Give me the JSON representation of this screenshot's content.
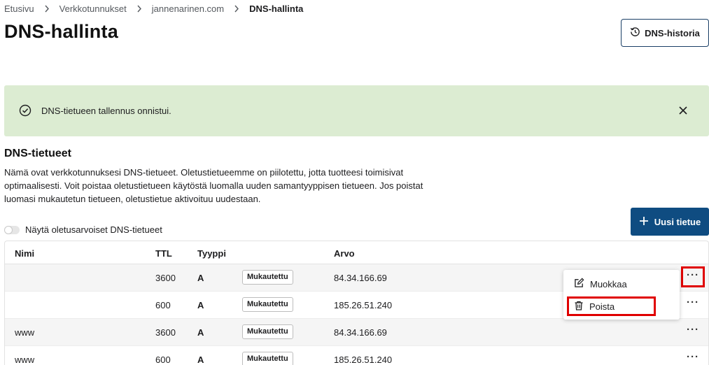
{
  "breadcrumb": [
    "Etusivu",
    "Verkkotunnukset",
    "jannenarinen.com",
    "DNS-hallinta"
  ],
  "page_title": "DNS-hallinta",
  "history_button": {
    "label": "DNS-historia",
    "icon": "history-icon"
  },
  "alert": {
    "message": "DNS-tietueen tallennus onnistui.",
    "color": "#dcecd2"
  },
  "section": {
    "title": "DNS-tietueet",
    "description": "Nämä ovat verkkotunnuksesi DNS-tietueet. Oletustietueemme on piilotettu, jotta tuotteesi toimisivat optimaalisesti. Voit poistaa oletustietueen käytöstä luomalla uuden samantyyppisen tietueen. Jos poistat luomasi mukautetun tietueen, oletustietue aktivoituu uudestaan."
  },
  "toggle": {
    "label": "Näytä oletusarvoiset DNS-tietueet",
    "on": false
  },
  "new_button": {
    "label": "Uusi tietue",
    "color": "#0f4c81"
  },
  "table": {
    "headers": {
      "name": "Nimi",
      "ttl": "TTL",
      "type": "Tyyppi",
      "value": "Arvo"
    },
    "rows": [
      {
        "name": "",
        "ttl": "3600",
        "type": "A",
        "badge": "Mukautettu",
        "value": "84.34.166.69"
      },
      {
        "name": "",
        "ttl": "600",
        "type": "A",
        "badge": "Mukautettu",
        "value": "185.26.51.240"
      },
      {
        "name": "www",
        "ttl": "3600",
        "type": "A",
        "badge": "Mukautettu",
        "value": "84.34.166.69"
      },
      {
        "name": "www",
        "ttl": "600",
        "type": "A",
        "badge": "Mukautettu",
        "value": "185.26.51.240"
      }
    ],
    "more_glyph": "···"
  },
  "context_menu": {
    "edit": "Muokkaa",
    "delete": "Poista"
  },
  "highlight_color": "#e00000"
}
